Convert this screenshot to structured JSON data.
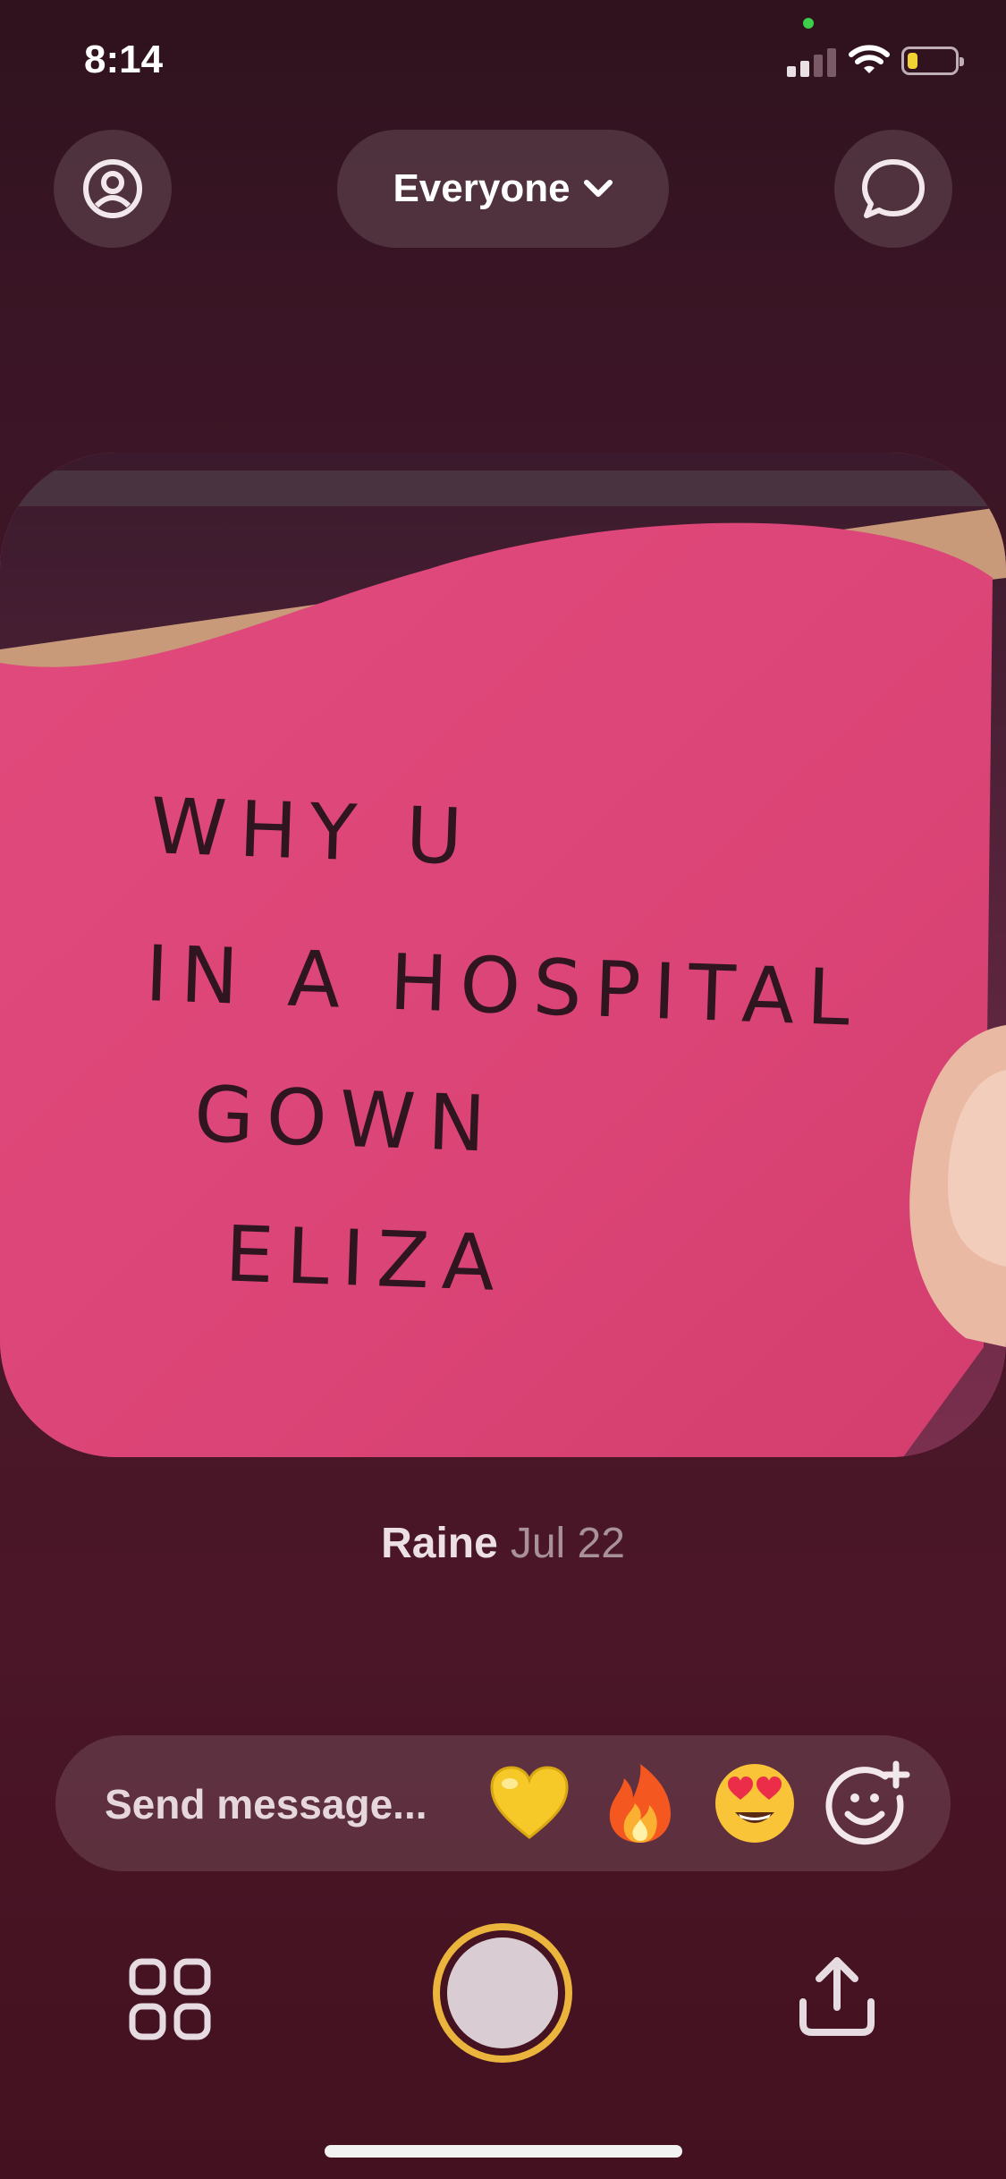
{
  "status_bar": {
    "time": "8:14",
    "signal_icon": "cellular-signal-icon",
    "wifi_icon": "wifi-icon",
    "battery_icon": "battery-icon",
    "battery_level": 0.2
  },
  "header": {
    "profile_icon": "profile-icon",
    "audience_label": "Everyone",
    "audience_chevron_icon": "chevron-down-icon",
    "chat_icon": "chat-bubble-icon"
  },
  "photo": {
    "handwritten_lines": [
      "WHY U",
      "IN A HOSPITAL",
      "GOWN",
      "ELIZA"
    ]
  },
  "caption": {
    "author": "Raine",
    "date": "Jul 22"
  },
  "message_bar": {
    "placeholder": "Send message...",
    "reactions": [
      "💛",
      "🔥",
      "😍"
    ],
    "add_reaction_icon": "add-reaction-icon"
  },
  "bottom_bar": {
    "grid_icon": "grid-icon",
    "shutter_icon": "shutter-button",
    "share_icon": "share-icon"
  },
  "colors": {
    "background": "#461828",
    "note_pink": "#e2507e",
    "shutter_ring": "#ebb43c",
    "battery_fill": "#f2d232"
  }
}
